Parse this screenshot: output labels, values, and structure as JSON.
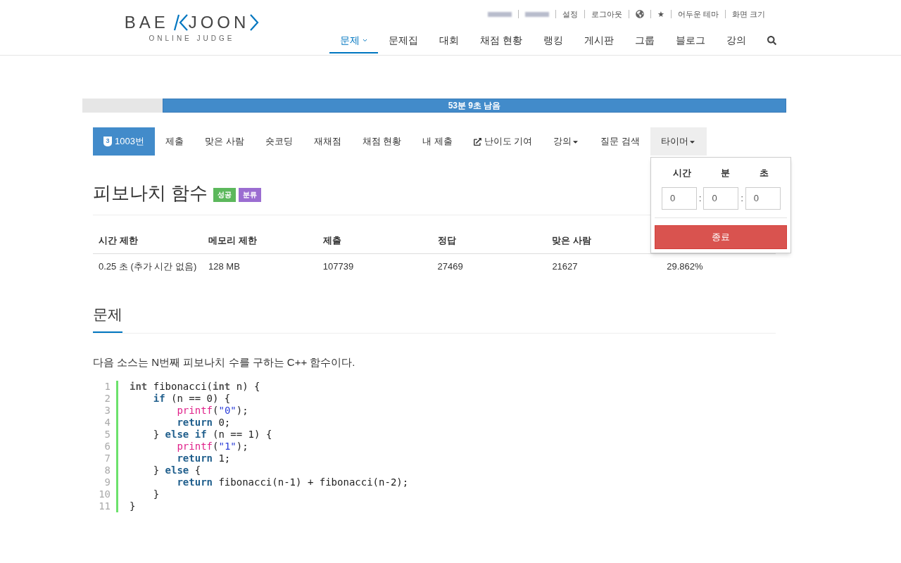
{
  "logo": {
    "left": "BAE",
    "right": "JOON",
    "subtitle": "ONLINE JUDGE"
  },
  "top_links": [
    {
      "kind": "redacted"
    },
    {
      "kind": "redacted"
    },
    {
      "kind": "text",
      "label": "설정"
    },
    {
      "kind": "text",
      "label": "로그아웃"
    },
    {
      "kind": "globe"
    },
    {
      "kind": "text",
      "label": "★"
    },
    {
      "kind": "text",
      "label": "어두운 테마"
    },
    {
      "kind": "text",
      "label": "화면 크기"
    }
  ],
  "main_nav": [
    {
      "label": "문제",
      "selected": true,
      "kind": "dropdown"
    },
    {
      "label": "문제집",
      "selected": false,
      "kind": "plain"
    },
    {
      "label": "대회",
      "selected": false,
      "kind": "plain"
    },
    {
      "label": "채점 현황",
      "selected": false,
      "kind": "plain"
    },
    {
      "label": "랭킹",
      "selected": false,
      "kind": "plain"
    },
    {
      "label": "게시판",
      "selected": false,
      "kind": "plain"
    },
    {
      "label": "그룹",
      "selected": false,
      "kind": "plain"
    },
    {
      "label": "블로그",
      "selected": false,
      "kind": "plain"
    },
    {
      "label": "강의",
      "selected": false,
      "kind": "plain"
    },
    {
      "selected": false,
      "kind": "search"
    }
  ],
  "timer_bar": {
    "level": 0.886,
    "label": "53분 9초 남음"
  },
  "problem_tabs": [
    {
      "label": "1003번",
      "kind": "tier",
      "tier": "3",
      "selected": true,
      "expanded": false
    },
    {
      "label": "제출",
      "kind": "plain",
      "selected": false,
      "expanded": false
    },
    {
      "label": "맞은 사람",
      "kind": "plain",
      "selected": false,
      "expanded": false
    },
    {
      "label": "숏코딩",
      "kind": "plain",
      "selected": false,
      "expanded": false
    },
    {
      "label": "재채점",
      "kind": "plain",
      "selected": false,
      "expanded": false
    },
    {
      "label": "채점 현황",
      "kind": "plain",
      "selected": false,
      "expanded": false
    },
    {
      "label": "내 제출",
      "kind": "plain",
      "selected": false,
      "expanded": false
    },
    {
      "label": "난이도 기여",
      "kind": "external",
      "selected": false,
      "expanded": false
    },
    {
      "label": "강의",
      "kind": "dropdown",
      "selected": false,
      "expanded": false
    },
    {
      "label": "질문 검색",
      "kind": "plain",
      "selected": false,
      "expanded": false
    },
    {
      "label": "타이머",
      "kind": "dropdown",
      "selected": false,
      "expanded": true
    }
  ],
  "timer_menu": {
    "fields": [
      {
        "label": "시간",
        "value": "0"
      },
      {
        "label": "분",
        "value": "0"
      },
      {
        "label": "초",
        "value": "0"
      }
    ],
    "separator": ":",
    "button": "종료"
  },
  "title": "피보나치 함수",
  "badges": [
    {
      "label": "성공",
      "color": "#5cb85c"
    },
    {
      "label": "분류",
      "color": "#9b6dd1"
    }
  ],
  "info_table": {
    "columns": [
      "시간 제한",
      "메모리 제한",
      "제출",
      "정답",
      "맞은 사람"
    ],
    "rows": [
      [
        "0.25 초 (추가 시간 없음)",
        "128 MB",
        "107739",
        "27469",
        "21627",
        "29.862%"
      ]
    ]
  },
  "section_title": "문제",
  "description": "다음 소스는 N번째 피보나치 수를 구하는 C++ 함수이다.",
  "code": [
    {
      "number": "1",
      "tokens": [
        {
          "text": "int",
          "kind": "type"
        },
        {
          "text": " fibonacci(",
          "kind": "plain"
        },
        {
          "text": "int",
          "kind": "type"
        },
        {
          "text": " n) {",
          "kind": "plain"
        }
      ]
    },
    {
      "number": "2",
      "tokens": [
        {
          "text": "    if",
          "kind": "keyword"
        },
        {
          "text": " (n == 0) {",
          "kind": "plain"
        }
      ]
    },
    {
      "number": "3",
      "tokens": [
        {
          "text": "        printf",
          "kind": "func"
        },
        {
          "text": "(",
          "kind": "plain"
        },
        {
          "text": "\"0\"",
          "kind": "string"
        },
        {
          "text": ");",
          "kind": "plain"
        }
      ]
    },
    {
      "number": "4",
      "tokens": [
        {
          "text": "        return",
          "kind": "keyword"
        },
        {
          "text": " 0;",
          "kind": "plain"
        }
      ]
    },
    {
      "number": "5",
      "tokens": [
        {
          "text": "    } ",
          "kind": "plain"
        },
        {
          "text": "else if",
          "kind": "keyword"
        },
        {
          "text": " (n == 1) {",
          "kind": "plain"
        }
      ]
    },
    {
      "number": "6",
      "tokens": [
        {
          "text": "        printf",
          "kind": "func"
        },
        {
          "text": "(",
          "kind": "plain"
        },
        {
          "text": "\"1\"",
          "kind": "string"
        },
        {
          "text": ");",
          "kind": "plain"
        }
      ]
    },
    {
      "number": "7",
      "tokens": [
        {
          "text": "        return",
          "kind": "keyword"
        },
        {
          "text": " 1;",
          "kind": "plain"
        }
      ]
    },
    {
      "number": "8",
      "tokens": [
        {
          "text": "    } ",
          "kind": "plain"
        },
        {
          "text": "else",
          "kind": "keyword"
        },
        {
          "text": " {",
          "kind": "plain"
        }
      ]
    },
    {
      "number": "9",
      "tokens": [
        {
          "text": "        return",
          "kind": "keyword"
        },
        {
          "text": " fibonacci(n-1) + fibonacci(n-2);",
          "kind": "plain"
        }
      ]
    },
    {
      "number": "10",
      "tokens": [
        {
          "text": "    }",
          "kind": "plain"
        }
      ]
    },
    {
      "number": "11",
      "tokens": [
        {
          "text": "}",
          "kind": "plain"
        }
      ]
    }
  ]
}
